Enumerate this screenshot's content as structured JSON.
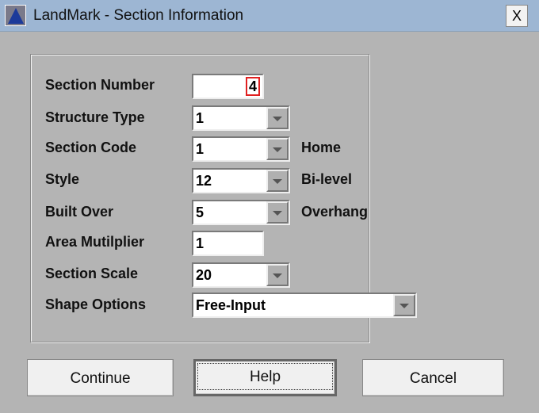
{
  "window": {
    "title": "LandMark - Section Information",
    "close_label": "X"
  },
  "fields": [
    {
      "label": "Section Number",
      "value": "4"
    },
    {
      "label": "Structure Type",
      "value": "1",
      "desc": ""
    },
    {
      "label": "Section Code",
      "value": "1",
      "desc": "Home"
    },
    {
      "label": "Style",
      "value": "12",
      "desc": "Bi-level"
    },
    {
      "label": "Built Over",
      "value": "5",
      "desc": "Overhang"
    },
    {
      "label": "Area Mutilplier",
      "value": "1"
    },
    {
      "label": "Section Scale",
      "value": "20"
    },
    {
      "label": "Shape Options",
      "value": "Free-Input"
    }
  ],
  "buttons": {
    "continue": "Continue",
    "help": "Help",
    "cancel": "Cancel"
  }
}
